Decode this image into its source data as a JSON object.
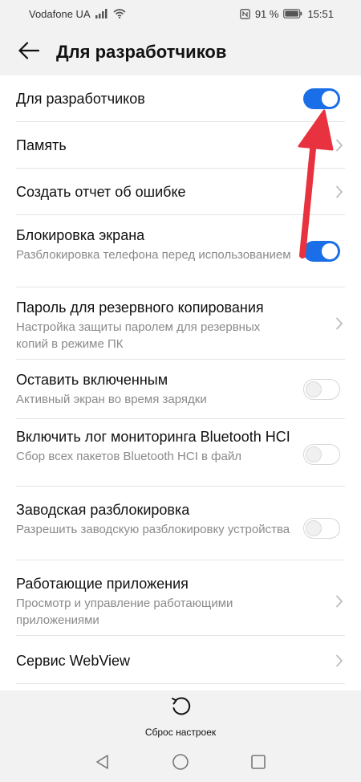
{
  "status_bar": {
    "carrier": "Vodafone UA",
    "battery_percent": "91 %",
    "time": "15:51",
    "icons": [
      "signal-icon",
      "wifi-icon",
      "nfc-icon",
      "vibrate-icon",
      "battery-icon"
    ]
  },
  "header": {
    "title": "Для разработчиков",
    "back_icon": "arrow-left-icon"
  },
  "rows": [
    {
      "title": "Для разработчиков",
      "control": "toggle",
      "on": true
    },
    {
      "title": "Память",
      "control": "chevron"
    },
    {
      "title": "Создать отчет об ошибке",
      "control": "chevron"
    },
    {
      "title": "Блокировка экрана",
      "subtitle": "Разблокировка телефона перед использованием",
      "control": "toggle",
      "on": true
    },
    {
      "title": "Пароль для резервного копирования",
      "subtitle": "Настройка защиты паролем для резервных копий в режиме ПК",
      "control": "chevron"
    },
    {
      "title": "Оставить включенным",
      "subtitle": "Активный экран во время зарядки",
      "control": "toggle",
      "on": false
    },
    {
      "title": "Включить лог мониторинга Bluetooth HCI",
      "subtitle": "Сбор всех пакетов Bluetooth HCI в файл",
      "control": "toggle",
      "on": false
    },
    {
      "title": "Заводская разблокировка",
      "subtitle": "Разрешить заводскую разблокировку устройства",
      "control": "toggle",
      "on": false
    },
    {
      "title": "Работающие приложения",
      "subtitle": "Просмотр и управление работающими приложениями",
      "control": "chevron"
    },
    {
      "title": "Сервис WebView",
      "control": "chevron"
    }
  ],
  "footer": {
    "reset_label": "Сброс настроек",
    "reset_icon": "reset-icon"
  },
  "nav_bar": {
    "icons": [
      "back-triangle-icon",
      "home-circle-icon",
      "recents-square-icon"
    ]
  },
  "colors": {
    "accent": "#1a6fe8",
    "annotation_arrow": "#e8323f",
    "background": "#f2f2f2",
    "card": "#ffffff",
    "secondary_text": "#8a8a8a"
  }
}
